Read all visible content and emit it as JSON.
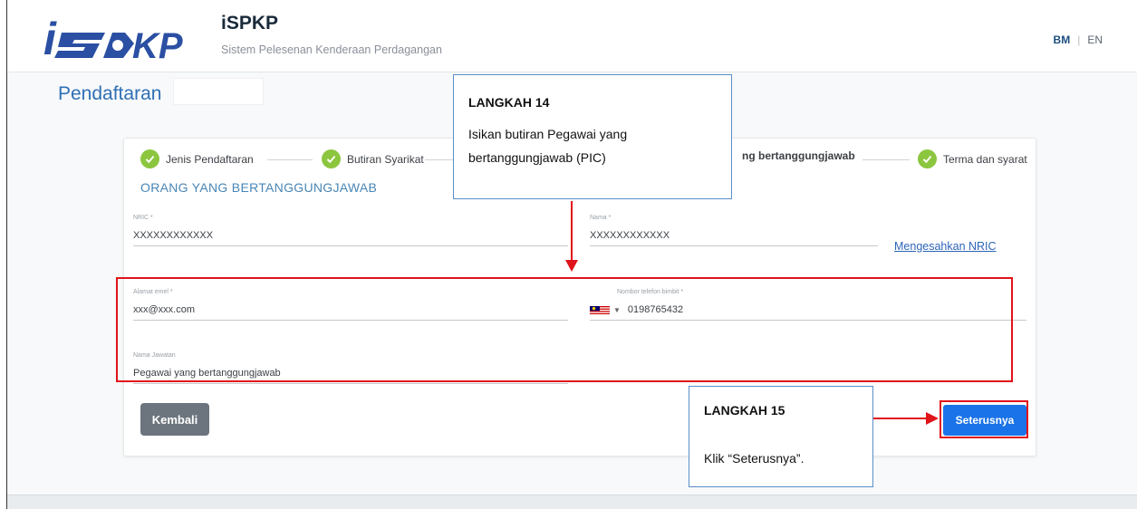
{
  "header": {
    "title": "iSPKP",
    "subtitle": "Sistem Pelesenan Kenderaan Perdagangan",
    "lang_bm": "BM",
    "lang_sep": "|",
    "lang_en": "EN",
    "logo_text": "iSPKP"
  },
  "page": {
    "title": "Pendaftaran"
  },
  "steps": [
    {
      "label": "Jenis Pendaftaran"
    },
    {
      "label": "Butiran Syarikat"
    },
    {
      "label": "ng bertanggungjawab"
    },
    {
      "label": "Terma dan syarat"
    }
  ],
  "section": {
    "title": "ORANG YANG BERTANGGUNGJAWAB"
  },
  "form": {
    "nric": {
      "label": "NRIC *",
      "value": "XXXXXXXXXXXX"
    },
    "nama": {
      "label": "Nama *",
      "value": "XXXXXXXXXXXX"
    },
    "verify_link": "Mengesahkan NRIC",
    "email": {
      "label": "Alamat emel *",
      "value": "xxx@xxx.com"
    },
    "phone": {
      "label": "Nombor telefon bimbit *",
      "value": "0198765432"
    },
    "jawatan": {
      "label": "Nama Jawatan",
      "value": "Pegawai yang bertanggungjawab"
    }
  },
  "buttons": {
    "back": "Kembali",
    "next": "Seterusnya"
  },
  "callouts": {
    "step14": {
      "heading": "LANGKAH 14",
      "body": "Isikan butiran Pegawai yang bertanggungjawab (PIC)"
    },
    "step15": {
      "heading": "LANGKAH 15",
      "body": "Klik “Seterusnya”."
    }
  },
  "colors": {
    "primary": "#1a73e8",
    "check": "#8cc63f",
    "highlight": "#e0131a",
    "title": "#2f6fb5"
  }
}
